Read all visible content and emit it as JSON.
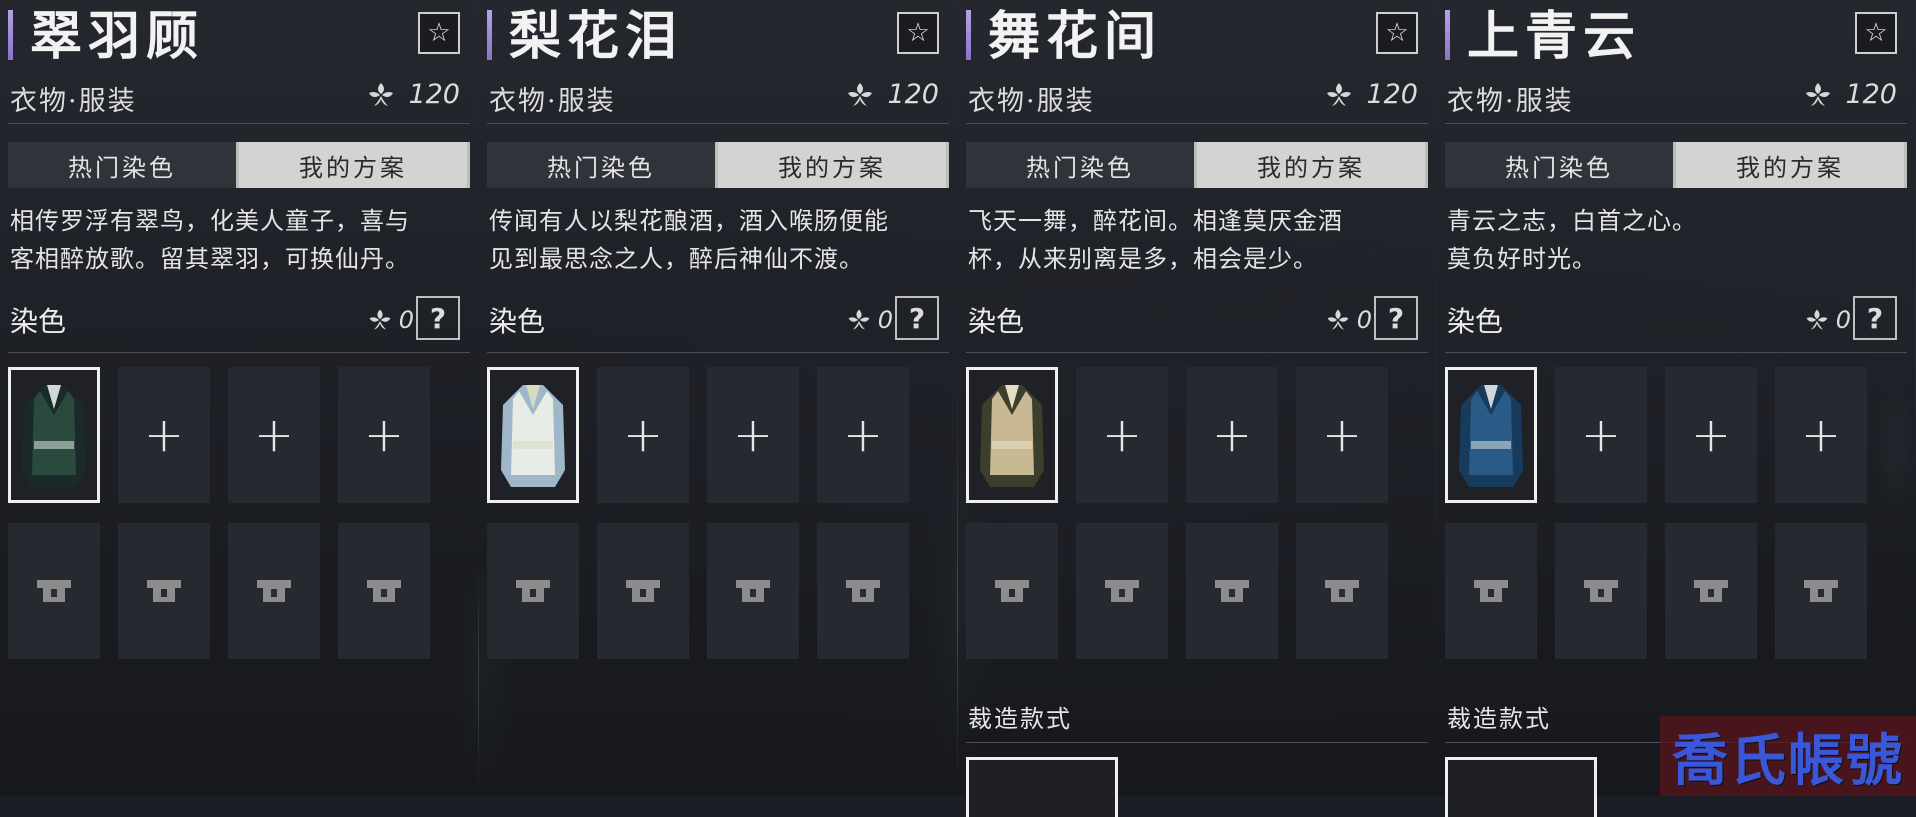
{
  "panels": [
    {
      "title": "翠羽顾",
      "subtitle": "衣物·服装",
      "price": "120",
      "tabs": [
        "热门染色",
        "我的方案"
      ],
      "active_tab": 1,
      "desc_lines": [
        "相传罗浮有翠鸟，化美人童子，喜与",
        "客相醉放歌。留其翠羽，可换仙丹。"
      ],
      "dye_label": "染色",
      "dye_count": "0",
      "help": "?",
      "outfit_colors": [
        "#2a4a3e",
        "#1a2a2a",
        "#cfd8d4"
      ],
      "tailor_label": ""
    },
    {
      "title": "梨花泪",
      "subtitle": "衣物·服装",
      "price": "120",
      "tabs": [
        "热门染色",
        "我的方案"
      ],
      "active_tab": 1,
      "desc_lines": [
        "传闻有人以梨花酿酒，酒入喉肠便能",
        "见到最思念之人，醉后神仙不渡。"
      ],
      "dye_label": "染色",
      "dye_count": "0",
      "help": "?",
      "outfit_colors": [
        "#e8ece6",
        "#9fb7c8",
        "#d7dcc0"
      ],
      "tailor_label": ""
    },
    {
      "title": "舞花间",
      "subtitle": "衣物·服装",
      "price": "120",
      "tabs": [
        "热门染色",
        "我的方案"
      ],
      "active_tab": 1,
      "desc_lines": [
        "飞天一舞，醉花间。相逢莫厌金酒",
        "杯，从来别离是多，相会是少。"
      ],
      "dye_label": "染色",
      "dye_count": "0",
      "help": "?",
      "outfit_colors": [
        "#c9b894",
        "#3b3f2c",
        "#e6dcc4"
      ],
      "tailor_label": "裁造款式"
    },
    {
      "title": "上青云",
      "subtitle": "衣物·服装",
      "price": "120",
      "tabs": [
        "热门染色",
        "我的方案"
      ],
      "active_tab": 1,
      "desc_lines": [
        "青云之志，白首之心。",
        "莫负好时光。"
      ],
      "dye_label": "染色",
      "dye_count": "0",
      "help": "?",
      "outfit_colors": [
        "#2a5a86",
        "#173b5c",
        "#cfd6dc"
      ],
      "tailor_label": "裁造款式"
    }
  ],
  "watermark": "喬氏帳號",
  "icons": {
    "favorite": "star-icon",
    "currency": "leaf-currency-icon",
    "locked": "lock-icon",
    "add": "plus-icon"
  }
}
